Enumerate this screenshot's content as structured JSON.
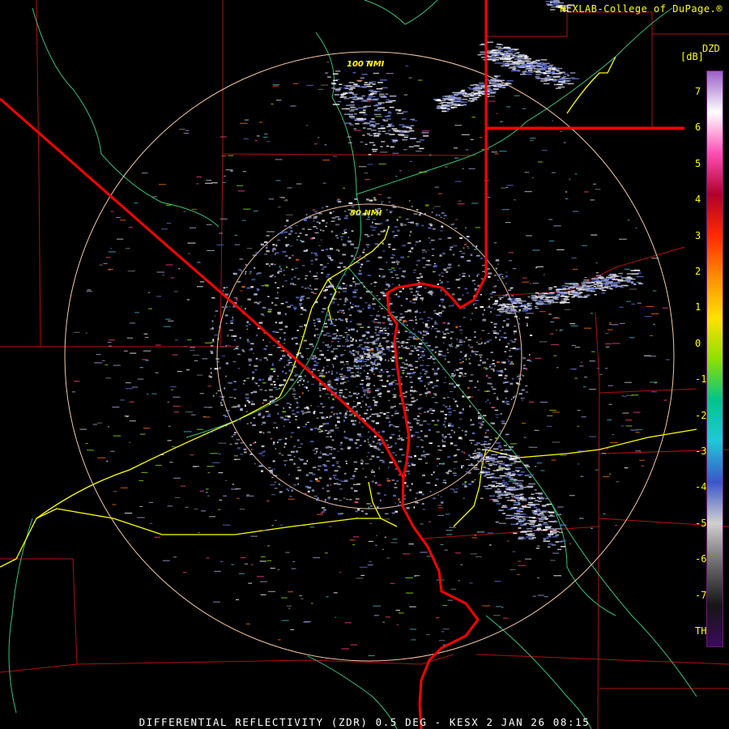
{
  "header": {
    "credit": "NEXLAB-College of DuPage.®"
  },
  "footer": {
    "caption": "DIFFERENTIAL REFLECTIVITY (ZDR) 0.5 DEG - KESX 2 JAN 26 08:15"
  },
  "map": {
    "range_rings": [
      {
        "label": "50 NMI"
      },
      {
        "label": "100 NMI"
      }
    ],
    "colors": {
      "state_border": "#ff0000",
      "county_line": "#b01010",
      "highway": "#ffff00",
      "river": "#35c27a",
      "range_ring": "#f2c7a3"
    }
  },
  "legend": {
    "product": "DZD",
    "unit": "[dB]",
    "ticks": [
      "7",
      "6",
      "5",
      "4",
      "3",
      "2",
      "1",
      "0",
      "-1",
      "-2",
      "-3",
      "-4",
      "-5",
      "-6",
      "-7",
      "TH"
    ],
    "gradient_colors": [
      "#9a5fc8",
      "#ffffff",
      "#ff4fb5",
      "#b0002a",
      "#ff2a00",
      "#ff8c00",
      "#ffe100",
      "#8fe000",
      "#00c58a",
      "#20c8d8",
      "#3b56c8",
      "#d0d0d0",
      "#6a6a6a",
      "#151515",
      "#3a0a5a"
    ]
  }
}
